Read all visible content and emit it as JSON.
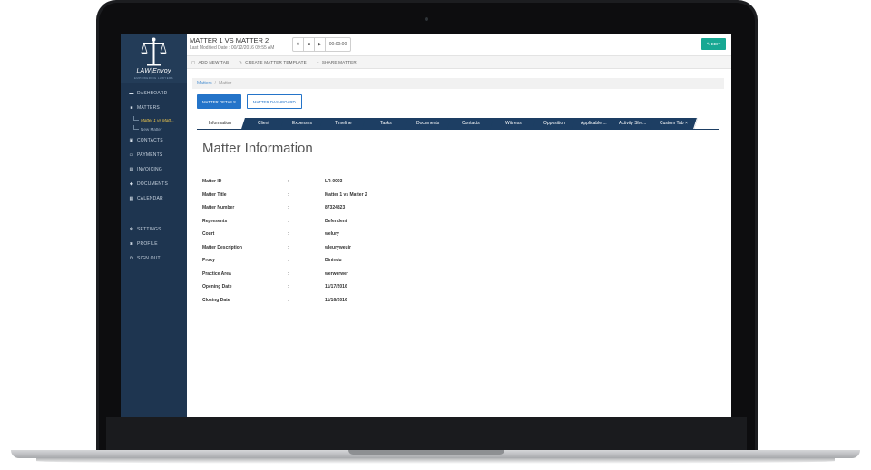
{
  "app": {
    "logo_name": "LAW|Envoy",
    "logo_tagline": "EMPOWERING LAWYERS"
  },
  "sidebar": {
    "items": [
      {
        "icon": "dashboard-icon",
        "label": "DASHBOARD"
      },
      {
        "icon": "briefcase-icon",
        "label": "MATTERS"
      },
      {
        "icon": "contacts-icon",
        "label": "CONTACTS"
      },
      {
        "icon": "payment-card-icon",
        "label": "PAYMENTS"
      },
      {
        "icon": "invoice-icon",
        "label": "INVOICING"
      },
      {
        "icon": "documents-icon",
        "label": "DOCUMENTS"
      },
      {
        "icon": "calendar-icon",
        "label": "CALENDAR"
      },
      {
        "icon": "gear-icon",
        "label": "SETTINGS"
      },
      {
        "icon": "profile-icon",
        "label": "PROFILE"
      },
      {
        "icon": "power-icon",
        "label": "SIGN OUT"
      }
    ],
    "matter_subitems": [
      {
        "label": "Matter 1 vs Matt..."
      },
      {
        "label": "New Matter"
      }
    ]
  },
  "header": {
    "matter_title": "MATTER 1 VS MATTER 2",
    "last_modified": "Last Modified Date : 00/12/2016 09:55 AM",
    "timer": {
      "stop": "✕",
      "pause": "■",
      "play": "▶",
      "time": "00:00:00"
    },
    "edit_label": "EDIT"
  },
  "toolbar": {
    "add_tab": "ADD NEW TAB",
    "create_template": "CREATE MATTER TEMPLATE",
    "share": "SHARE MATTER"
  },
  "breadcrumb": {
    "root": "Matters",
    "separator": "/",
    "current": "Matter"
  },
  "view_buttons": {
    "details": "MATTER DETAILS",
    "dashboard": "MATTER DASHBOARD"
  },
  "tabs": [
    {
      "label": "Information",
      "active": true
    },
    {
      "label": "Client"
    },
    {
      "label": "Expenses"
    },
    {
      "label": "Timeline"
    },
    {
      "label": "Tasks"
    },
    {
      "label": "Documents"
    },
    {
      "label": "Contacts"
    },
    {
      "label": "Witness"
    },
    {
      "label": "Opposition"
    },
    {
      "label": "Applicable ..."
    },
    {
      "label": "Activity She..."
    },
    {
      "label": "Custom Tab ×"
    }
  ],
  "section_title": "Matter Information",
  "details": [
    {
      "label": "Matter ID",
      "value": "LR-0003"
    },
    {
      "label": "Matter Title",
      "value": "Matter 1 vs Matter 2"
    },
    {
      "label": "Matter Number",
      "value": "87324823"
    },
    {
      "label": "Represents",
      "value": "Defendent"
    },
    {
      "label": "Court",
      "value": "welury"
    },
    {
      "label": "Matter Description",
      "value": "wleuryweuir"
    },
    {
      "label": "Proxy",
      "value": "Dinindu"
    },
    {
      "label": "Practice Area",
      "value": "werwerwer"
    },
    {
      "label": "Opening Date",
      "value": "11/17/2016"
    },
    {
      "label": "Closing Date",
      "value": "11/16/2016"
    }
  ],
  "colors": {
    "sidebar": "#1e3550",
    "tab": "#1d3e63",
    "primary": "#2474c9",
    "edit": "#17a893",
    "active_subitem": "#f2c94c"
  }
}
